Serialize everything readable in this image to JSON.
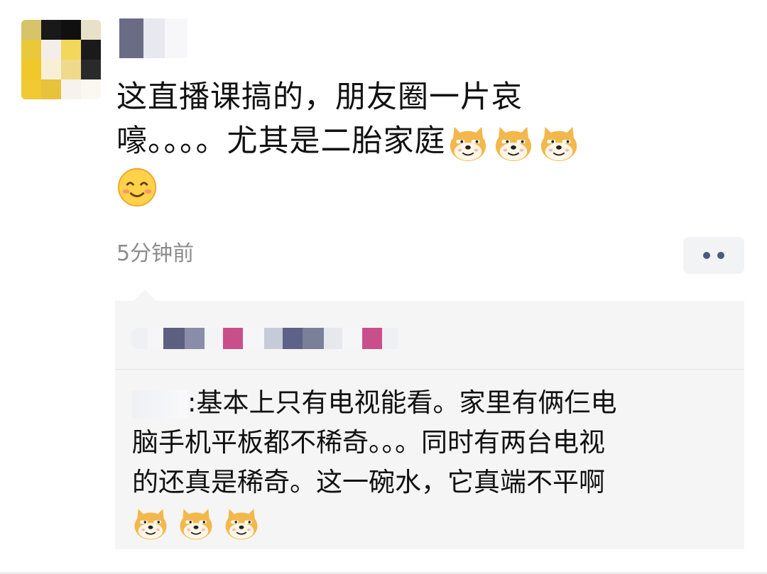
{
  "post": {
    "line1": "这直播课搞的，朋友圈一片哀",
    "line2": "嚎。。。。尤其是二胎家庭",
    "time": "5分钟前"
  },
  "comment": {
    "separator": ":",
    "line1": "基本上只有电视能看。家里有俩仨电",
    "line2": "脑手机平板都不稀奇。。。同时有两台电视",
    "line3": "的还真是稀奇。这一碗水，它真端不平啊"
  },
  "icons": {
    "emoji_doge": "doge-emoji",
    "emoji_smile": "smile-emoji",
    "more": "more-dots-icon"
  },
  "colors": {
    "text": "#111111",
    "time": "#8c8c8c",
    "comment_bg": "#f5f5f5",
    "more_dots": "#4a5a7c"
  }
}
